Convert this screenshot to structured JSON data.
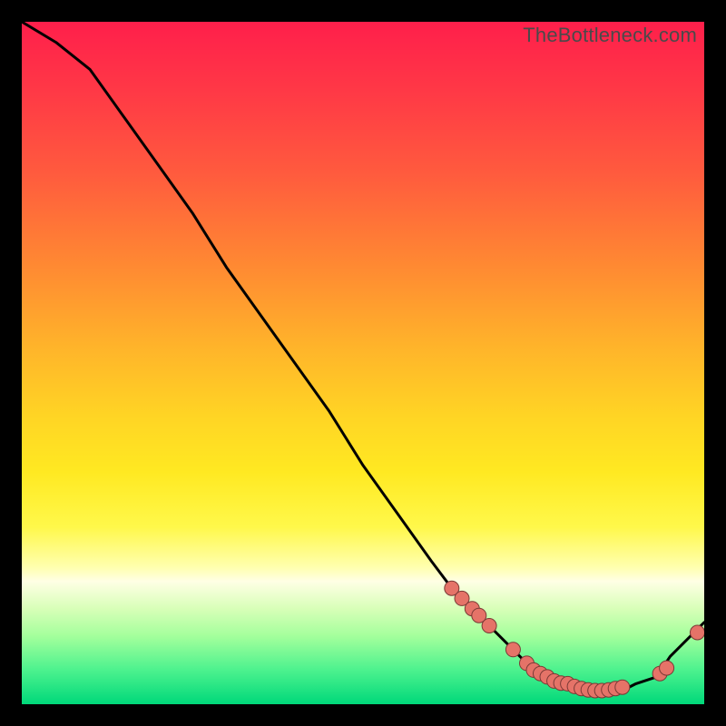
{
  "watermark": "TheBottleneck.com",
  "colors": {
    "line": "#000000",
    "marker_fill": "#e57368",
    "marker_stroke": "#7b3a36"
  },
  "chart_data": {
    "type": "line",
    "title": "",
    "xlabel": "",
    "ylabel": "",
    "xlim": [
      0,
      100
    ],
    "ylim": [
      0,
      100
    ],
    "series": [
      {
        "name": "bottleneck-curve",
        "x": [
          0,
          5,
          10,
          15,
          20,
          25,
          30,
          35,
          40,
          45,
          50,
          55,
          60,
          63,
          67,
          70,
          72,
          75,
          78,
          80,
          82,
          85,
          88,
          90,
          93,
          95,
          98,
          100
        ],
        "y": [
          100,
          97,
          93,
          86,
          79,
          72,
          64,
          57,
          50,
          43,
          35,
          28,
          21,
          17,
          13,
          10,
          8,
          5,
          3,
          3,
          2,
          2,
          2,
          3,
          4,
          7,
          10,
          12
        ]
      }
    ],
    "markers": {
      "name": "highlighted-points",
      "x": [
        63,
        64.5,
        66,
        67,
        68.5,
        72,
        74,
        75,
        76,
        77,
        78,
        79,
        80,
        81,
        82,
        83,
        84,
        85,
        86,
        87,
        88,
        93.5,
        94.5,
        99
      ],
      "y": [
        17,
        15.5,
        14,
        13,
        11.5,
        8,
        6,
        5,
        4.5,
        4,
        3.4,
        3.1,
        3,
        2.6,
        2.3,
        2.1,
        2,
        2,
        2.1,
        2.3,
        2.5,
        4.5,
        5.3,
        10.5
      ]
    }
  }
}
